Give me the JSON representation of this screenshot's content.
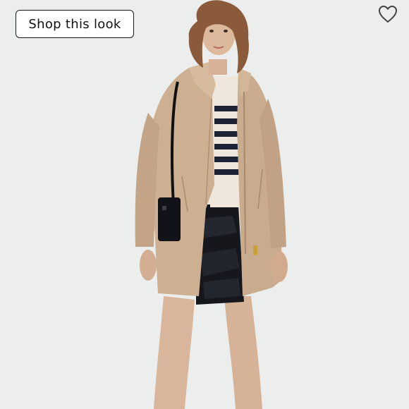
{
  "shop_button": {
    "label": "Shop this look"
  },
  "favorite": {
    "icon": "heart-outline-icon",
    "color": "#444444"
  },
  "photo": {
    "subject": "product-photo"
  },
  "colors": {
    "background": "#eceeed",
    "coat": "#cdb092",
    "button_border": "#1a1a1a"
  }
}
